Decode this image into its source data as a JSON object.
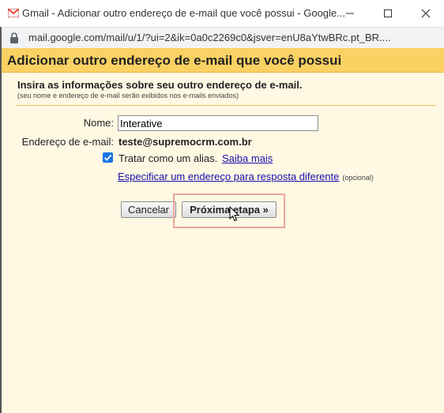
{
  "window": {
    "title": "Gmail - Adicionar outro endereço de e-mail que você possui - Google...",
    "url": "mail.google.com/mail/u/1/?ui=2&ik=0a0c2269c0&jsver=enU8aYtwBRc.pt_BR....",
    "minimize_glyph": "—",
    "maximize_glyph": "☐",
    "close_glyph": "✕"
  },
  "page": {
    "title": "Adicionar outro endereço de e-mail que você possui",
    "instruction": "Insira as informações sobre seu outro endereço de e-mail.",
    "note": "(seu nome e endereço de e-mail serão exibidos nos e-mails enviados)"
  },
  "form": {
    "name_label": "Nome:",
    "name_value": "Interative",
    "email_label": "Endereço de e-mail:",
    "email_value": "teste@supremocrm.com.br",
    "alias_checked": true,
    "alias_label": "Tratar como um alias.",
    "learn_more_link": "Saiba mais",
    "reply_to_link": "Especificar um endereço para resposta diferente",
    "reply_to_optional": "(opcional)"
  },
  "buttons": {
    "cancel": "Cancelar",
    "next": "Próxima etapa »"
  },
  "icons": {
    "favicon": "gmail-icon",
    "lock": "lock-icon",
    "cursor": "mouse-pointer-icon"
  },
  "colors": {
    "header_bg": "#fad163",
    "panel_bg": "#fff9e4",
    "link": "#1a0dab",
    "checkbox": "#1a73e8",
    "highlight": "#f0a59a"
  }
}
